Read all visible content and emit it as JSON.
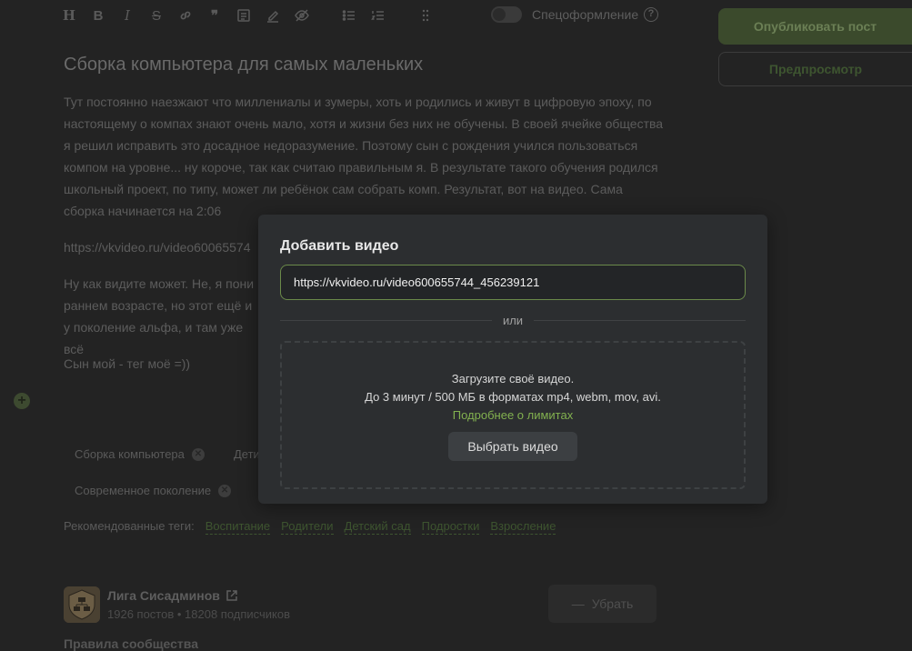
{
  "editor": {
    "toolbar": {
      "icons": [
        "heading-icon",
        "bold-icon",
        "italic-icon",
        "strikethrough-icon",
        "link-icon",
        "quote-icon",
        "code-block-icon",
        "marker-icon",
        "hide-icon",
        "bullet-list-icon",
        "numbered-list-icon",
        "drag-handle-icon"
      ],
      "spec_label": "Спецоформление",
      "help": "?"
    },
    "title": "Сборка компьютера для самых маленьких",
    "paragraphs": [
      "Тут постоянно наезжают что миллениалы и зумеры, хоть и родились и живут в цифровую эпоху, по настоящему о компах знают очень мало, хотя и жизни без них не обучены. В своей ячейке общества я решил исправить это досадное недоразумение. Поэтому сын с рождения учился пользоваться компом на уровне... ну короче, так как считаю правильным я. В результате такого обучения родился школьный проект, по типу, может ли ребёнок сам собрать комп. Результат, вот на видео. Сама сборка начинается на 2:06",
      "https://vkvideo.ru/video60065574",
      "Ну как видите может. Не, я пони раннем возрасте, но этот ещё и у поколение альфа, и там уже всё",
      "Сын мой - тег моё =))"
    ],
    "add_block": "+",
    "tags": [
      "Сборка компьютера",
      "Дети",
      "Современное поколение"
    ],
    "recommended_label": "Рекомендованные теги:",
    "recommended": [
      "Воспитание",
      "Родители",
      "Детский сад",
      "Подростки",
      "Взросление"
    ],
    "community": {
      "name": "Лига Сисадминов",
      "stats": "1926 постов • 18208 подписчиков",
      "remove_label": "Убрать",
      "rules_label": "Правила сообщества"
    }
  },
  "sidebar": {
    "publish_label": "Опубликовать пост",
    "preview_label": "Предпросмотр"
  },
  "modal": {
    "title": "Добавить видео",
    "url_value": "https://vkvideo.ru/video600655744_456239121",
    "or_label": "или",
    "upload_line1": "Загрузите своё видео.",
    "upload_line2": "До 3 минут / 500 МБ в форматах mp4, webm, mov, avi.",
    "limits_link": "Подробнее о лимитах",
    "choose_label": "Выбрать видео"
  },
  "colors": {
    "accent": "#82b14f",
    "background": "#232323",
    "modal_bg": "#2c2e30"
  }
}
